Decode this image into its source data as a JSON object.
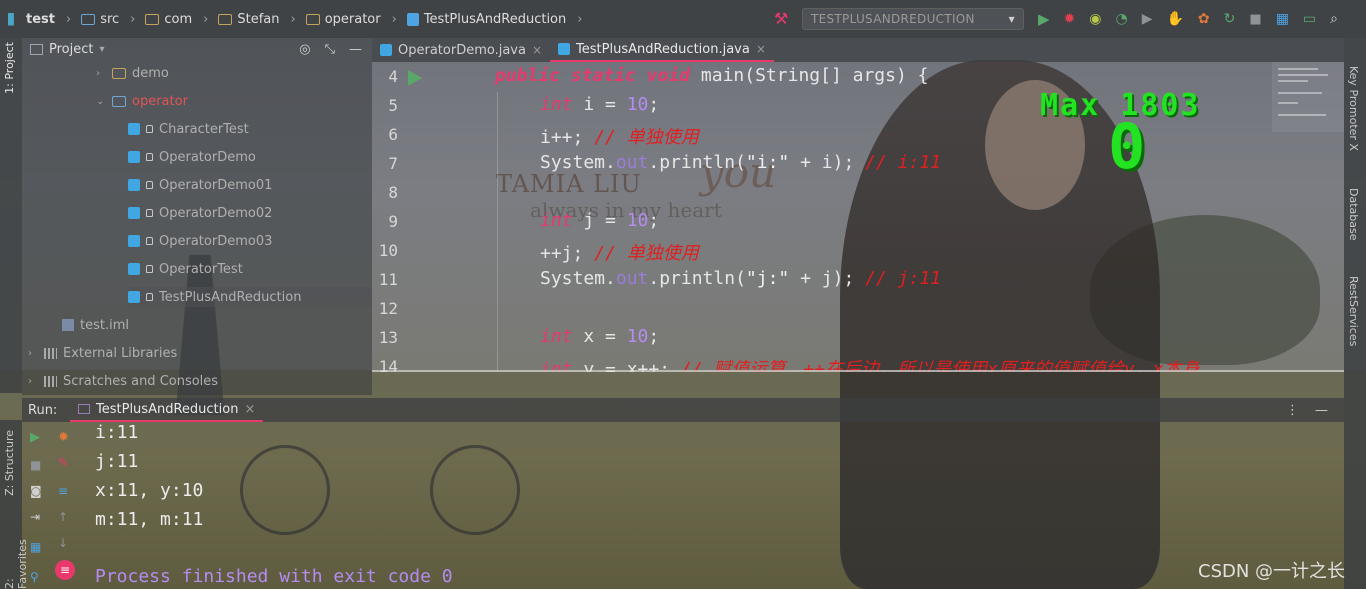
{
  "colors": {
    "accent": "#e9386c",
    "keyword": "#e53a6d",
    "number": "#b48cf0",
    "comment": "#e02020",
    "score": "#22e222"
  },
  "breadcrumb": [
    {
      "label": "test",
      "icon": "module-icon"
    },
    {
      "label": "src",
      "icon": "source-folder-icon"
    },
    {
      "label": "com",
      "icon": "folder-icon"
    },
    {
      "label": "Stefan",
      "icon": "folder-icon"
    },
    {
      "label": "operator",
      "icon": "folder-icon"
    },
    {
      "label": "TestPlusAndReduction",
      "icon": "java-class-icon"
    }
  ],
  "toolbar": {
    "run_config": "TESTPLUSANDREDUCTION"
  },
  "left_tabs": {
    "project": "1: Project",
    "structure": "Z: Structure",
    "favorites": "2: Favorites"
  },
  "right_tabs": {
    "key_promoter": "Key Promoter X",
    "database": "Database",
    "rest": "RestServices"
  },
  "project": {
    "title": "Project",
    "tree": [
      {
        "label": "demo",
        "type": "folder",
        "expanded": false
      },
      {
        "label": "operator",
        "type": "folder",
        "expanded": true
      },
      {
        "label": "CharacterTest",
        "type": "class"
      },
      {
        "label": "OperatorDemo",
        "type": "class"
      },
      {
        "label": "OperatorDemo01",
        "type": "class"
      },
      {
        "label": "OperatorDemo02",
        "type": "class"
      },
      {
        "label": "OperatorDemo03",
        "type": "class"
      },
      {
        "label": "OperatorTest",
        "type": "class"
      },
      {
        "label": "TestPlusAndReduction",
        "type": "class"
      },
      {
        "label": "test.iml",
        "type": "iml"
      },
      {
        "label": "External Libraries",
        "type": "library"
      },
      {
        "label": "Scratches and Consoles",
        "type": "scratches"
      }
    ]
  },
  "editor": {
    "tabs": [
      {
        "label": "OperatorDemo.java",
        "active": false
      },
      {
        "label": "TestPlusAndReduction.java",
        "active": true
      }
    ],
    "line_numbers": [
      "4",
      "5",
      "6",
      "7",
      "8",
      "9",
      "10",
      "11",
      "12",
      "13",
      "14"
    ],
    "lines": {
      "l4": {
        "kw": "public static void",
        "rest": " main(String[] args) {"
      },
      "l5": {
        "kw": "int",
        "a": " i = ",
        "n": "10",
        "b": ";"
      },
      "l6": {
        "a": "i++; ",
        "c": "// 单独使用"
      },
      "l7": {
        "a": "System.",
        "f": "out",
        "b": ".println(",
        "s": "\"i:\"",
        "d": " + i); ",
        "c": "// i:11"
      },
      "l9": {
        "kw": "int",
        "a": " j = ",
        "n": "10",
        "b": ";"
      },
      "l10": {
        "a": "++j; ",
        "c": "// 单独使用"
      },
      "l11": {
        "a": "System.",
        "f": "out",
        "b": ".println(",
        "s": "\"j:\"",
        "d": " + j); ",
        "c": "// j:11"
      },
      "l13": {
        "kw": "int",
        "a": " x = ",
        "n": "10",
        "b": ";"
      },
      "l14": {
        "kw": "int",
        "a": " y = x++; ",
        "c": "// 赋值运算，++在后边，所以是使用x原来的值赋值给y，x本身"
      }
    }
  },
  "overlay_game": {
    "max_label": "Max 1803",
    "score": "0"
  },
  "watermark": {
    "brand": "TAMIA LIU",
    "script": "you",
    "sub": "always in my heart"
  },
  "run": {
    "label": "Run:",
    "tab": "TestPlusAndReduction",
    "output": [
      "i:11",
      "j:11",
      "x:11, y:10",
      "m:11, m:11"
    ],
    "finished": "Process finished with exit code 0"
  },
  "csdn": "CSDN @一计之长"
}
